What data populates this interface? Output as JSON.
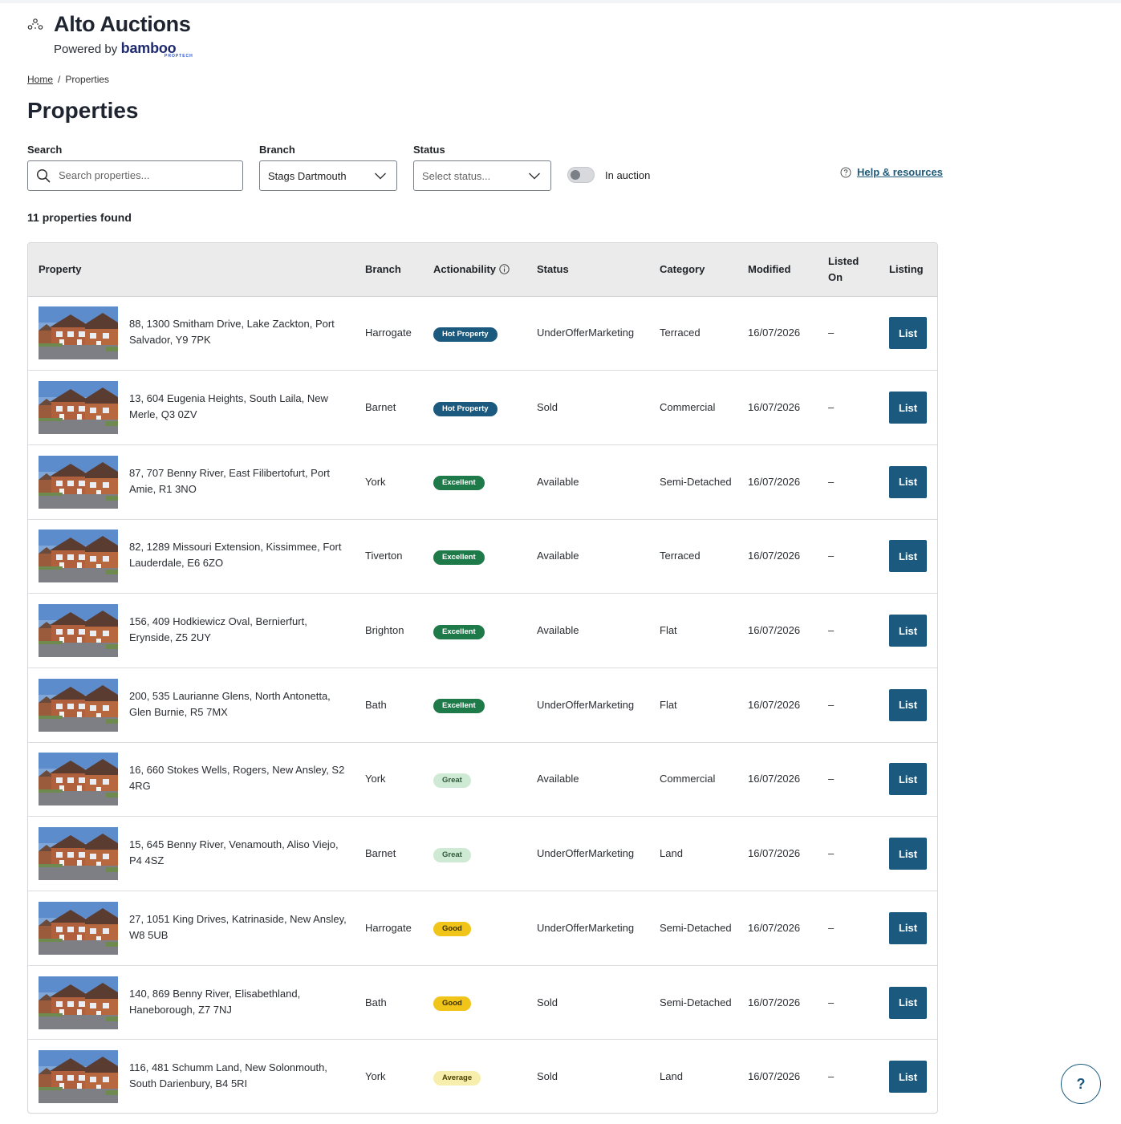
{
  "app": {
    "title": "Alto Auctions",
    "powered_by": "Powered by",
    "partner": "bamboo",
    "partner_tag": "PROPTECH"
  },
  "breadcrumb": {
    "home": "Home",
    "separator": "/",
    "current": "Properties"
  },
  "page": {
    "title": "Properties"
  },
  "filters": {
    "search_label": "Search",
    "search_placeholder": "Search properties...",
    "branch_label": "Branch",
    "branch_value": "Stags Dartmouth",
    "status_label": "Status",
    "status_placeholder": "Select status...",
    "toggle_label": "In auction",
    "toggle_on": false,
    "help_label": "Help & resources"
  },
  "results": {
    "count_text": "11 properties found"
  },
  "table": {
    "headers": {
      "property": "Property",
      "branch": "Branch",
      "actionability": "Actionability",
      "status": "Status",
      "category": "Category",
      "modified": "Modified",
      "listed_on": "Listed On",
      "listing": "Listing"
    },
    "rows": [
      {
        "address": "88, 1300 Smitham Drive, Lake Zackton, Port Salvador, Y9 7PK",
        "branch": "Harrogate",
        "actionability": "Hot Property",
        "level": "hot",
        "status": "UnderOfferMarketing",
        "category": "Terraced",
        "modified": "16/07/2026",
        "listed_on": "–",
        "action": "List"
      },
      {
        "address": "13, 604 Eugenia Heights, South Laila, New Merle, Q3 0ZV",
        "branch": "Barnet",
        "actionability": "Hot Property",
        "level": "hot",
        "status": "Sold",
        "category": "Commercial",
        "modified": "16/07/2026",
        "listed_on": "–",
        "action": "List"
      },
      {
        "address": "87, 707 Benny River, East Filibertofurt, Port Amie, R1 3NO",
        "branch": "York",
        "actionability": "Excellent",
        "level": "excellent",
        "status": "Available",
        "category": "Semi-Detached",
        "modified": "16/07/2026",
        "listed_on": "–",
        "action": "List"
      },
      {
        "address": "82, 1289 Missouri Extension, Kissimmee, Fort Lauderdale, E6 6ZO",
        "branch": "Tiverton",
        "actionability": "Excellent",
        "level": "excellent",
        "status": "Available",
        "category": "Terraced",
        "modified": "16/07/2026",
        "listed_on": "–",
        "action": "List"
      },
      {
        "address": "156, 409 Hodkiewicz Oval, Bernierfurt, Erynside, Z5 2UY",
        "branch": "Brighton",
        "actionability": "Excellent",
        "level": "excellent",
        "status": "Available",
        "category": "Flat",
        "modified": "16/07/2026",
        "listed_on": "–",
        "action": "List"
      },
      {
        "address": "200, 535 Laurianne Glens, North Antonetta, Glen Burnie, R5 7MX",
        "branch": "Bath",
        "actionability": "Excellent",
        "level": "excellent",
        "status": "UnderOfferMarketing",
        "category": "Flat",
        "modified": "16/07/2026",
        "listed_on": "–",
        "action": "List"
      },
      {
        "address": "16, 660 Stokes Wells, Rogers, New Ansley, S2 4RG",
        "branch": "York",
        "actionability": "Great",
        "level": "great",
        "status": "Available",
        "category": "Commercial",
        "modified": "16/07/2026",
        "listed_on": "–",
        "action": "List"
      },
      {
        "address": "15, 645 Benny River, Venamouth, Aliso Viejo, P4 4SZ",
        "branch": "Barnet",
        "actionability": "Great",
        "level": "great",
        "status": "UnderOfferMarketing",
        "category": "Land",
        "modified": "16/07/2026",
        "listed_on": "–",
        "action": "List"
      },
      {
        "address": "27, 1051 King Drives, Katrinaside, New Ansley, W8 5UB",
        "branch": "Harrogate",
        "actionability": "Good",
        "level": "good",
        "status": "UnderOfferMarketing",
        "category": "Semi-Detached",
        "modified": "16/07/2026",
        "listed_on": "–",
        "action": "List"
      },
      {
        "address": "140, 869 Benny River, Elisabethland, Haneborough, Z7 7NJ",
        "branch": "Bath",
        "actionability": "Good",
        "level": "good",
        "status": "Sold",
        "category": "Semi-Detached",
        "modified": "16/07/2026",
        "listed_on": "–",
        "action": "List"
      },
      {
        "address": "116, 481 Schumm Land, New Solonmouth, South Darienbury, B4 5RI",
        "branch": "York",
        "actionability": "Average",
        "level": "average",
        "status": "Sold",
        "category": "Land",
        "modified": "16/07/2026",
        "listed_on": "–",
        "action": "List"
      }
    ]
  },
  "help_fab": {
    "label": "?"
  },
  "colors": {
    "primary": "#1b5a7e",
    "excellent": "#1f7a4a",
    "great": "#cfead4",
    "good": "#f0c419",
    "average": "#f7eeae"
  }
}
